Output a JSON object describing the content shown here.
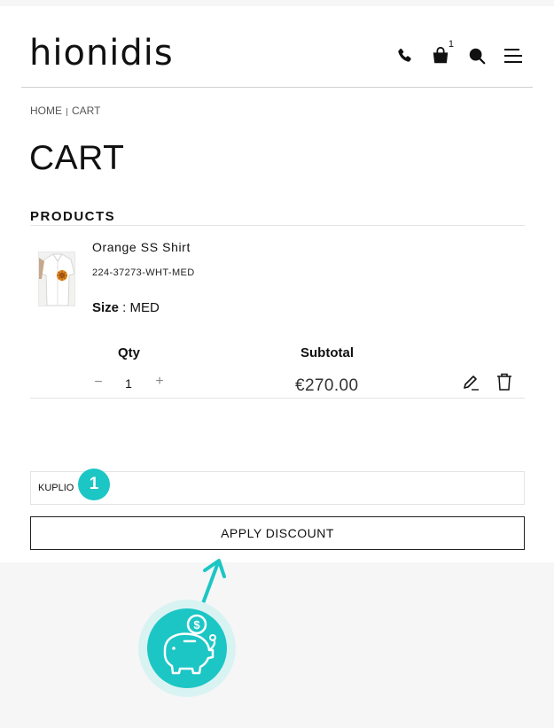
{
  "header": {
    "logo_text": "hionidis",
    "cart_count": "1",
    "icons": [
      "phone-icon",
      "shopping-bag-icon",
      "search-icon",
      "menu-icon"
    ]
  },
  "breadcrumb": {
    "home": "HOME",
    "current": "CART"
  },
  "page_title": "CART",
  "products_heading": "PRODUCTS",
  "product": {
    "name": "Orange SS Shirt",
    "sku": "224-37273-WHT-MED",
    "size_label": "Size",
    "size_separator": " : ",
    "size_value": "MED",
    "qty_label": "Qty",
    "subtotal_label": "Subtotal",
    "quantity": "1",
    "minus": "−",
    "plus": "+",
    "price": "€270.00"
  },
  "discount": {
    "code_value": "KUPLIO",
    "apply_label": "APPLY DISCOUNT",
    "step_badge": "1"
  },
  "colors": {
    "accent": "#1cc6c5",
    "accent_light": "#d9f3f3"
  }
}
